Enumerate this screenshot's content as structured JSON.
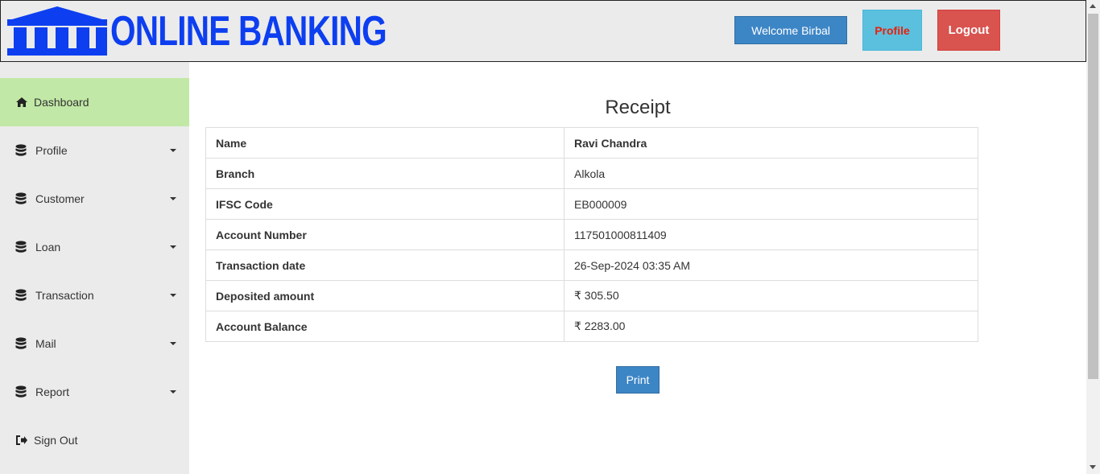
{
  "header": {
    "logo_text": "ONLINE BANKING",
    "welcome_label": "Welcome Birbal",
    "profile_label": "Profile",
    "logout_label": "Logout"
  },
  "sidebar": {
    "items": [
      {
        "label": "Dashboard",
        "icon": "home-icon",
        "active": true
      },
      {
        "label": "Profile",
        "icon": "database-icon"
      },
      {
        "label": "Customer",
        "icon": "database-icon"
      },
      {
        "label": "Loan",
        "icon": "database-icon"
      },
      {
        "label": "Transaction",
        "icon": "database-icon"
      },
      {
        "label": "Mail",
        "icon": "database-icon"
      },
      {
        "label": "Report",
        "icon": "database-icon"
      },
      {
        "label": "Sign Out",
        "icon": "sign-out-icon"
      }
    ]
  },
  "receipt": {
    "title": "Receipt",
    "rows": [
      {
        "label": "Name",
        "value": "Ravi Chandra"
      },
      {
        "label": "Branch",
        "value": "Alkola"
      },
      {
        "label": "IFSC Code",
        "value": "EB000009"
      },
      {
        "label": "Account Number",
        "value": "117501000811409"
      },
      {
        "label": "Transaction date",
        "value": "26-Sep-2024 03:35 AM"
      },
      {
        "label": "Deposited amount",
        "value": "₹ 305.50"
      },
      {
        "label": "Account Balance",
        "value": "₹ 2283.00"
      }
    ],
    "print_label": "Print"
  },
  "colors": {
    "brand": "#0d3ff0",
    "active_nav": "#c1e8a6",
    "primary_button": "#3d86c6",
    "info_button": "#5bc0de",
    "danger_button": "#d9534f"
  }
}
